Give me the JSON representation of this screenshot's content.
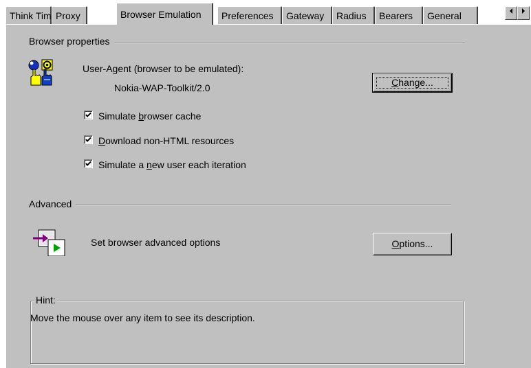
{
  "tabs": [
    {
      "label": "Think Time"
    },
    {
      "label": "Proxy"
    },
    {
      "label": "Browser Emulation"
    },
    {
      "label": "Preferences"
    },
    {
      "label": "Gateway"
    },
    {
      "label": "Radius"
    },
    {
      "label": "Bearers"
    },
    {
      "label": "General"
    }
  ],
  "active_tab": "Browser Emulation",
  "browser_properties": {
    "group_label": "Browser properties",
    "user_agent_label": "User-Agent (browser to be emulated):",
    "user_agent_value": "Nokia-WAP-Toolkit/2.0",
    "change_button": {
      "pre": "",
      "mnemonic": "C",
      "post": "hange..."
    },
    "checkboxes": [
      {
        "pre": "Simulate ",
        "mnemonic": "b",
        "post": "rowser cache",
        "checked": true
      },
      {
        "pre": "",
        "mnemonic": "D",
        "post": "ownload non-HTML resources",
        "checked": true
      },
      {
        "pre": "Simulate a ",
        "mnemonic": "n",
        "post": "ew user each iteration",
        "checked": true
      }
    ]
  },
  "advanced": {
    "group_label": "Advanced",
    "description": "Set browser advanced options",
    "options_button": {
      "pre": "",
      "mnemonic": "O",
      "post": "ptions..."
    }
  },
  "hint": {
    "label": "Hint:",
    "text": "Move the mouse over any item to see its description."
  },
  "colors": {
    "face": "#c0c0c0",
    "shadow": "#808080",
    "highlight": "#ffffff"
  },
  "icons": {
    "browser": "browser-hands-icon",
    "advanced": "advanced-options-icon",
    "scroll_left": "scroll-left-icon",
    "scroll_right": "scroll-right-icon"
  }
}
